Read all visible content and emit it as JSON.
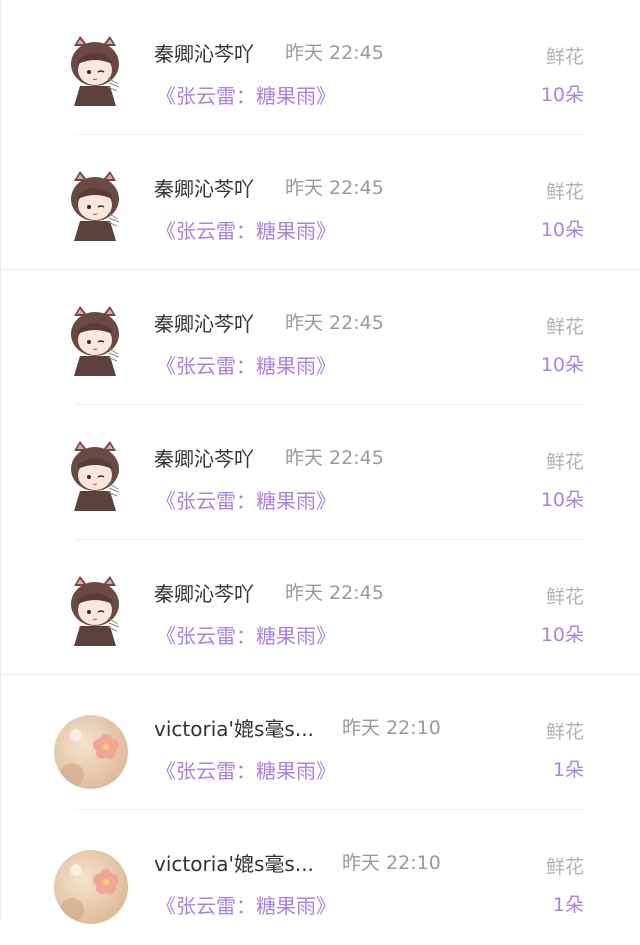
{
  "rows": [
    {
      "avatar": "cat-girl-avatar",
      "name": "秦卿沁芩吖",
      "time": "昨天 22:45",
      "title": "《张云雷：糖果雨》",
      "gift": "鲜花",
      "count": "10朵"
    },
    {
      "avatar": "cat-girl-avatar",
      "name": "秦卿沁芩吖",
      "time": "昨天 22:45",
      "title": "《张云雷：糖果雨》",
      "gift": "鲜花",
      "count": "10朵"
    },
    {
      "avatar": "cat-girl-avatar",
      "name": "秦卿沁芩吖",
      "time": "昨天 22:45",
      "title": "《张云雷：糖果雨》",
      "gift": "鲜花",
      "count": "10朵"
    },
    {
      "avatar": "cat-girl-avatar",
      "name": "秦卿沁芩吖",
      "time": "昨天 22:45",
      "title": "《张云雷：糖果雨》",
      "gift": "鲜花",
      "count": "10朵"
    },
    {
      "avatar": "cat-girl-avatar",
      "name": "秦卿沁芩吖",
      "time": "昨天 22:45",
      "title": "《张云雷：糖果雨》",
      "gift": "鲜花",
      "count": "10朵"
    },
    {
      "avatar": "flower-avatar",
      "name": "victoria'媲s毫s...",
      "time": "昨天 22:10",
      "title": "《张云雷：糖果雨》",
      "gift": "鲜花",
      "count": "1朵"
    },
    {
      "avatar": "flower-avatar",
      "name": "victoria'媲s毫s...",
      "time": "昨天 22:10",
      "title": "《张云雷：糖果雨》",
      "gift": "鲜花",
      "count": "1朵"
    }
  ],
  "colors": {
    "accent": "#a983df",
    "name": "#333333",
    "muted": "#9a9a9a"
  }
}
